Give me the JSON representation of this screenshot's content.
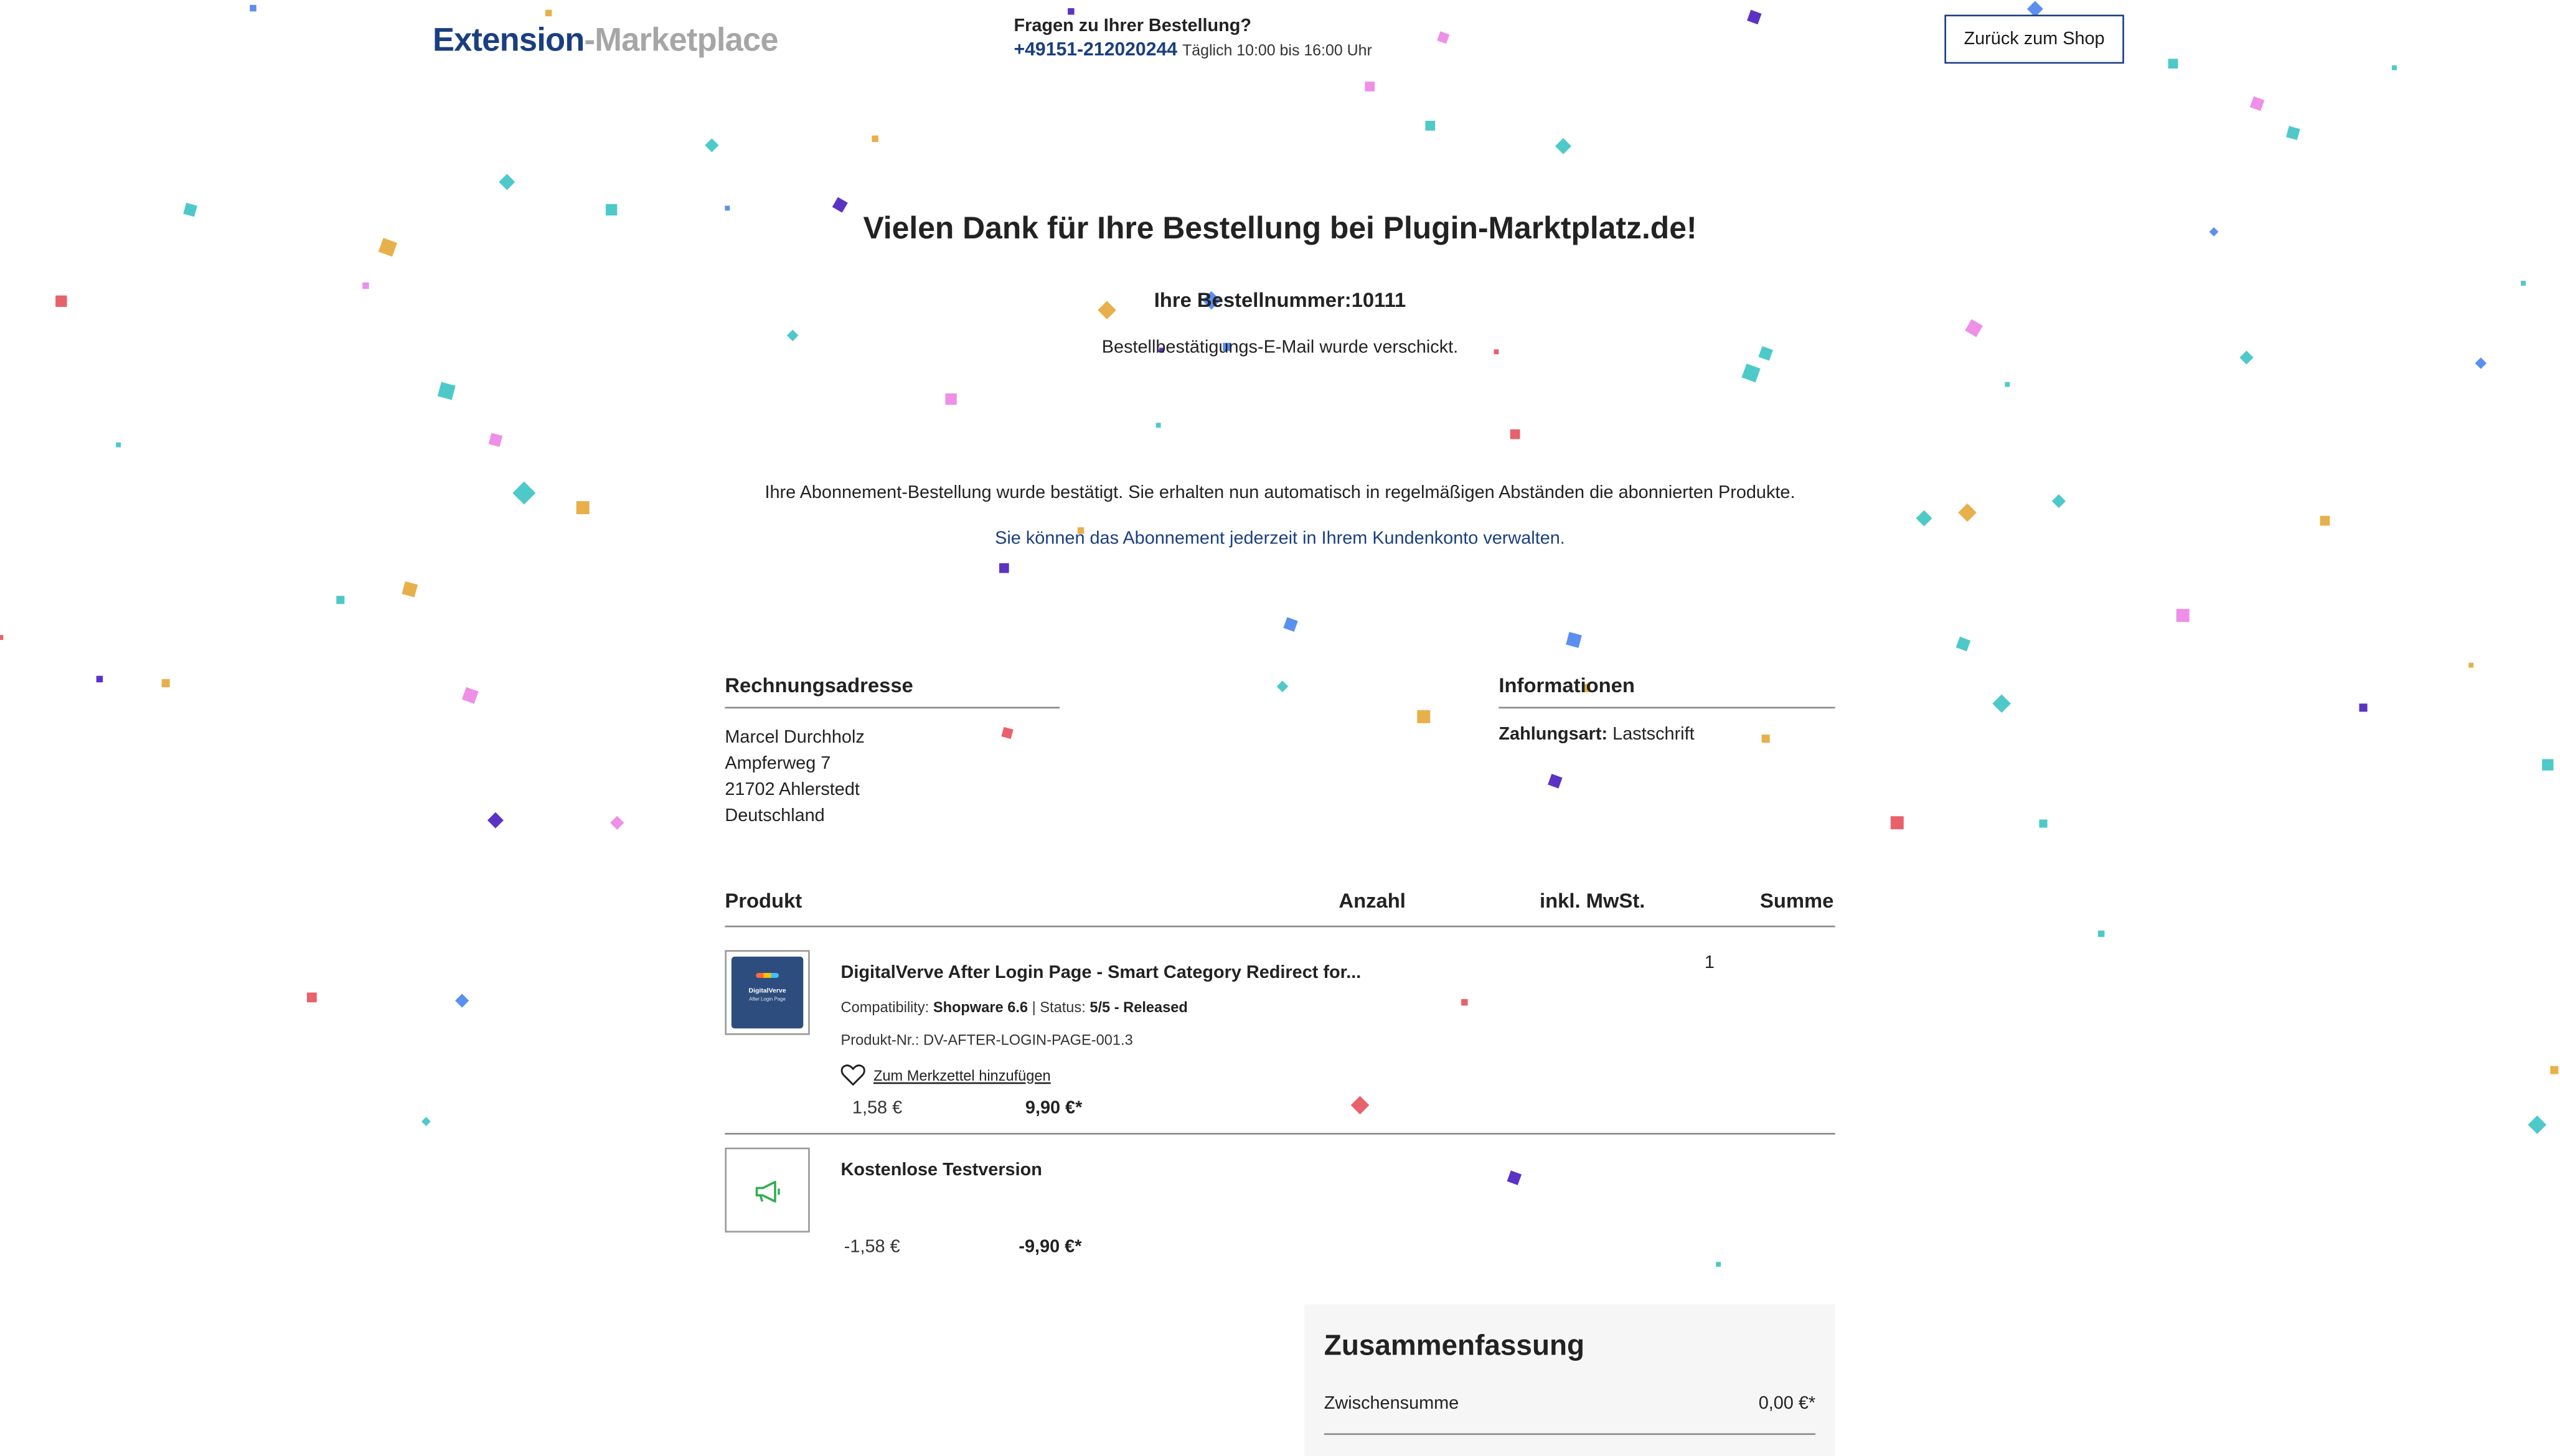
{
  "header": {
    "logo_main": "Extension",
    "logo_suffix": "-Marketplace",
    "help_question": "Fragen zu Ihrer Bestellung?",
    "phone": "+49151-212020244",
    "hours": "Täglich 10:00 bis 16:00 Uhr",
    "back_button": "Zurück zum Shop"
  },
  "confirmation": {
    "title": "Vielen Dank für Ihre Bestellung bei Plugin-Marktplatz.de!",
    "order_number_label": "Ihre Bestellnummer:",
    "order_number": "10111",
    "mail_sent": "Bestellbestätigungs-E-Mail wurde verschickt.",
    "subscription_text": "Ihre Abonnement-Bestellung wurde bestätigt. Sie erhalten nun automatisch in regelmäßigen Abständen die abonnierten Produkte.",
    "subscription_link": "Sie können das Abonnement jederzeit in Ihrem Kundenkonto verwalten."
  },
  "billing": {
    "heading": "Rechnungsadresse",
    "name": "Marcel Durchholz",
    "street": "Ampferweg 7",
    "city": "21702 Ahlerstedt",
    "country": "Deutschland"
  },
  "info": {
    "heading": "Informationen",
    "payment_label": "Zahlungsart:",
    "payment_value": "Lastschrift"
  },
  "table": {
    "col_product": "Produkt",
    "col_qty": "Anzahl",
    "col_tax": "inkl. MwSt.",
    "col_sum": "Summe"
  },
  "items": [
    {
      "name": "DigitalVerve After Login Page - Smart Category Redirect for...",
      "thumb_title": "DigitalVerve",
      "thumb_subtitle": "After Login Page",
      "compat_label": "Compatibility:",
      "compat_value": "Shopware 6.6",
      "status_label": "Status:",
      "status_value": "5/5 - Released",
      "sku_label": "Produkt-Nr.:",
      "sku": "DV-AFTER-LOGIN-PAGE-001.3",
      "wishlist": "Zum Merkzettel hinzufügen",
      "qty": "1",
      "tax": "1,58 €",
      "sum": "9,90 €*"
    },
    {
      "name": "Kostenlose Testversion",
      "icon": "megaphone-icon",
      "tax": "-1,58 €",
      "sum": "-9,90 €*"
    }
  ],
  "summary": {
    "heading": "Zusammenfassung",
    "subtotal_label": "Zwischensumme",
    "subtotal_value": "0,00 €*"
  },
  "colors": {
    "brand": "#1a3f80",
    "logo_suffix": "#a6a6a6",
    "confetti": [
      "#4ec9c9",
      "#5b8ff0",
      "#e8b04a",
      "#5b33c4",
      "#ee8fe8",
      "#e8616b"
    ]
  }
}
